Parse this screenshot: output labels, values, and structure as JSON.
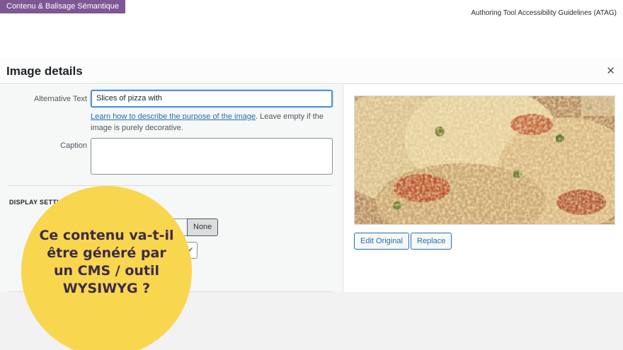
{
  "slide": {
    "section_tag": "Contenu & Balisage Sémantique",
    "header_reference": "Authoring Tool Accessibility Guidelines (ATAG)",
    "callout": "Ce contenu va-t-il être généré par un CMS / outil WYSIWYG ?",
    "colors": {
      "tag": "#7f5795",
      "callout_bg": "#f8d64e",
      "callout_text": "#3c2a4a"
    }
  },
  "modal": {
    "title": "Image details",
    "close_icon": "close-icon",
    "alt_text": {
      "label": "Alternative Text",
      "value": "Slices of pizza with",
      "help_link": "Learn how to describe the purpose of the image",
      "help_text": ". Leave empty if the image is purely decorative."
    },
    "caption": {
      "label": "Caption",
      "value": ""
    },
    "display_settings": {
      "heading": "DISPLAY SETTINGS",
      "heading_visible": "DISPLAY SETTI",
      "align_selected": "None"
    },
    "preview": {
      "image": "pizza-photo"
    },
    "buttons": {
      "edit": "Edit Original",
      "replace": "Replace"
    }
  }
}
